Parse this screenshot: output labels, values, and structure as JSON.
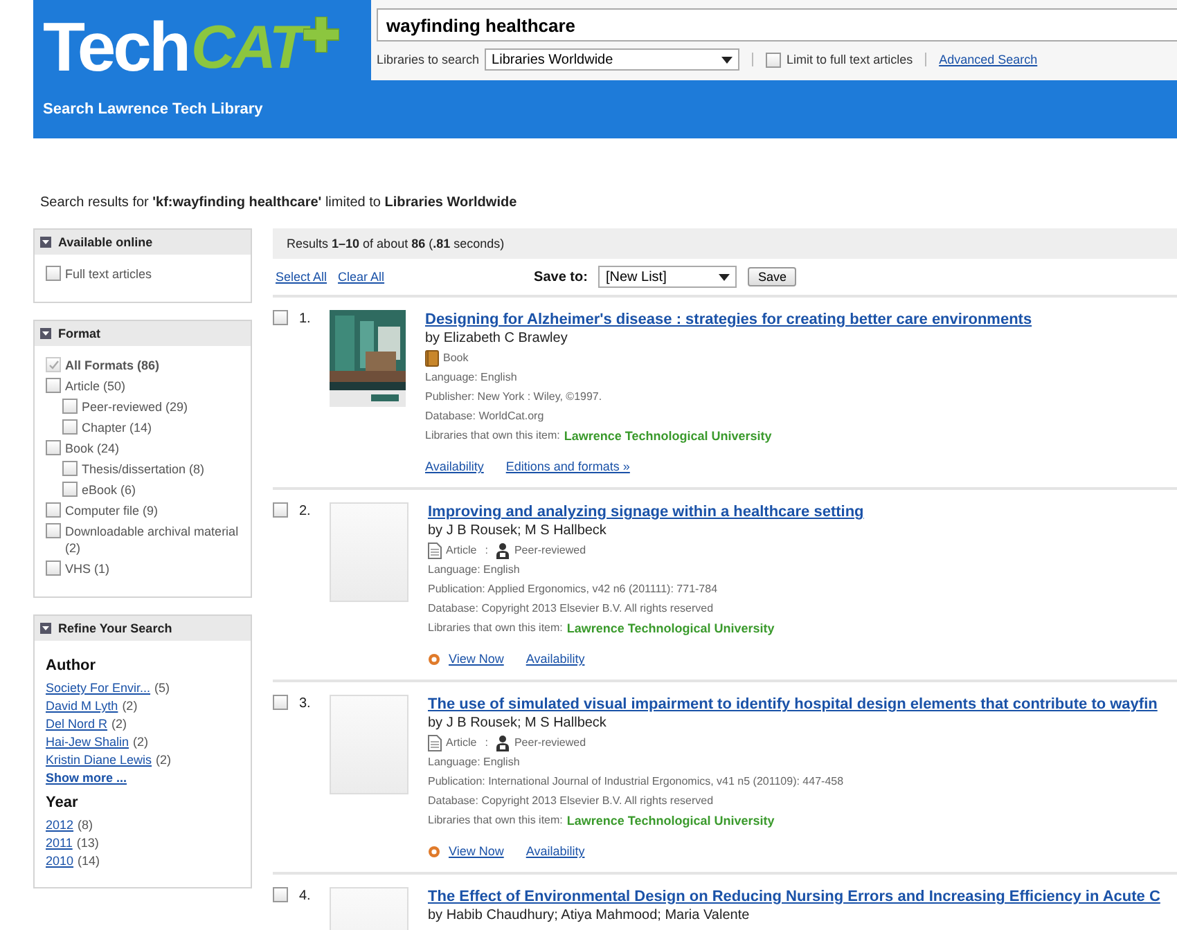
{
  "header": {
    "logo": {
      "part1": "Tech",
      "part2": "CAT"
    },
    "tagline": "Search Lawrence Tech Library",
    "search": {
      "value": "wayfinding healthcare"
    },
    "scope_label": "Libraries to search",
    "scope_value": "Libraries Worldwide",
    "fulltext": {
      "label": "Limit to full text articles",
      "checked": false
    },
    "advanced_link": "Advanced Search"
  },
  "summary": "Search results for **'kf:wayfinding healthcare'** limited to **Libraries Worldwide**",
  "sidebar": [
    {
      "title": "Available online",
      "kind": "checks",
      "items": [
        {
          "label": "Full text articles",
          "checked": false
        }
      ]
    },
    {
      "title": "Format",
      "kind": "checks",
      "items": [
        {
          "label": "All Formats (86)",
          "checked": true
        },
        {
          "label": "Article (50)",
          "checked": false,
          "children": [
            {
              "label": "Peer-reviewed (29)",
              "checked": false
            },
            {
              "label": "Chapter (14)",
              "checked": false
            }
          ]
        },
        {
          "label": "Book (24)",
          "checked": false,
          "children": [
            {
              "label": "Thesis/dissertation (8)",
              "checked": false
            },
            {
              "label": "eBook (6)",
              "checked": false
            }
          ]
        },
        {
          "label": "Computer file (9)",
          "checked": false
        },
        {
          "label": "Downloadable archival material (2)",
          "checked": false
        },
        {
          "label": "VHS (1)",
          "checked": false
        }
      ]
    },
    {
      "title": "Refine Your Search",
      "kind": "facets",
      "groups": [
        {
          "heading": "Author",
          "items": [
            {
              "label": "Society For Envir...",
              "count": "(5)"
            },
            {
              "label": "David M Lyth",
              "count": "(2)"
            },
            {
              "label": "Del Nord R",
              "count": "(2)"
            },
            {
              "label": "Hai-Jew Shalin",
              "count": "(2)"
            },
            {
              "label": "Kristin Diane Lewis",
              "count": "(2)"
            }
          ],
          "more": "Show more ..."
        },
        {
          "heading": "Year",
          "items": [
            {
              "label": "2012",
              "count": "(8)"
            },
            {
              "label": "2011",
              "count": "(13)"
            },
            {
              "label": "2010",
              "count": "(14)"
            }
          ]
        }
      ]
    }
  ],
  "results_bar": "Results **1–10** of about **86** (**.81** seconds)",
  "toolbar": {
    "select_all": "Select All",
    "clear_all": "Clear All",
    "save_to_label": "Save to:",
    "list_value": "[New List]",
    "save_button": "Save"
  },
  "results": [
    {
      "number": "1.",
      "checked": false,
      "cover_image": true,
      "title": "Designing for Alzheimer's disease : strategies for creating better care environments",
      "authors": "by Elizabeth C Brawley",
      "format": {
        "kind": "book",
        "label": "Book"
      },
      "details": [
        "Language: English",
        "Publisher: New York : Wiley, ©1997.",
        "Database: WorldCat.org"
      ],
      "holdings_label": "Libraries that own this item:",
      "holdings": "Lawrence Technological University",
      "links": [
        "Availability",
        "Editions and formats »"
      ]
    },
    {
      "number": "2.",
      "checked": false,
      "cover_image": false,
      "title": "Improving and analyzing signage within a healthcare setting",
      "authors": "by J B Rousek; M S Hallbeck",
      "format": {
        "kind": "article",
        "label": "Article",
        "separator": ":",
        "peer": "Peer-reviewed"
      },
      "details": [
        "Language: English",
        "Publication: Applied Ergonomics, v42 n6 (201111): 771-784",
        "Database: Copyright 2013 Elsevier B.V. All rights reserved"
      ],
      "holdings_label": "Libraries that own this item:",
      "holdings": "Lawrence Technological University",
      "view_now": "View Now",
      "links": [
        "Availability"
      ]
    },
    {
      "number": "3.",
      "checked": false,
      "cover_image": false,
      "title": "The use of simulated visual impairment to identify hospital design elements that contribute to wayfin",
      "authors": "by J B Rousek; M S Hallbeck",
      "format": {
        "kind": "article",
        "label": "Article",
        "separator": ":",
        "peer": "Peer-reviewed"
      },
      "details": [
        "Language: English",
        "Publication: International Journal of Industrial Ergonomics, v41 n5 (201109): 447-458",
        "Database: Copyright 2013 Elsevier B.V. All rights reserved"
      ],
      "holdings_label": "Libraries that own this item:",
      "holdings": "Lawrence Technological University",
      "view_now": "View Now",
      "links": [
        "Availability"
      ]
    },
    {
      "number": "4.",
      "checked": false,
      "cover_image": false,
      "title": "The Effect of Environmental Design on Reducing Nursing Errors and Increasing Efficiency in Acute C",
      "authors": "by Habib Chaudhury; Atiya Mahmood; Maria Valente"
    }
  ]
}
